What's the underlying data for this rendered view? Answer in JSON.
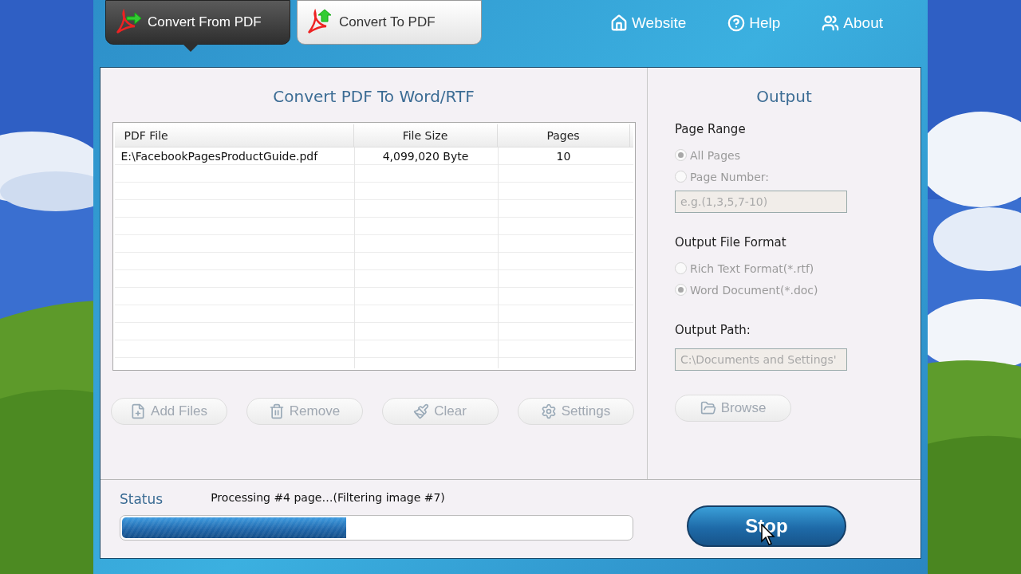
{
  "tabs": [
    {
      "label": "Convert From PDF",
      "selected": true
    },
    {
      "label": "Convert To PDF",
      "selected": false
    }
  ],
  "nav_links": [
    {
      "label": "Website",
      "kind": "home"
    },
    {
      "label": "Help",
      "kind": "help"
    },
    {
      "label": "About",
      "kind": "users"
    }
  ],
  "converter": {
    "title": "Convert PDF To Word/RTF",
    "table": {
      "columns": [
        "PDF File",
        "File Size",
        "Pages"
      ],
      "rows": [
        [
          "E:\\FacebookPagesProductGuide.pdf",
          "4,099,020 Byte",
          "10"
        ]
      ]
    },
    "buttons": [
      {
        "label": "Add Files",
        "kind": "add",
        "disabled": true
      },
      {
        "label": "Remove",
        "kind": "remove",
        "disabled": true
      },
      {
        "label": "Clear",
        "kind": "clear",
        "disabled": true
      },
      {
        "label": "Settings",
        "kind": "settings",
        "disabled": true
      }
    ]
  },
  "output": {
    "title": "Output",
    "page_range": {
      "label": "Page Range",
      "options": [
        {
          "label": "All Pages",
          "selected": true,
          "disabled": true
        },
        {
          "label": "Page Number:",
          "selected": false,
          "disabled": true
        }
      ],
      "field": {
        "placeholder": "e.g.(1,3,5,7-10)",
        "disabled": true
      }
    },
    "format": {
      "label": "Output File Format",
      "options": [
        {
          "label": "Rich Text Format(*.rtf)",
          "selected": false,
          "disabled": true
        },
        {
          "label": "Word Document(*.doc)",
          "selected": true,
          "disabled": true
        }
      ]
    },
    "path": {
      "label": "Output Path:",
      "value": "C:\\Documents and Settings'",
      "disabled": true
    },
    "browse": {
      "label": "Browse",
      "kind": "folder",
      "disabled": true
    }
  },
  "status": {
    "label": "Status",
    "message": "Processing #4 page…(Filtering image #7)",
    "level": 0.44,
    "stop": "Stop"
  }
}
